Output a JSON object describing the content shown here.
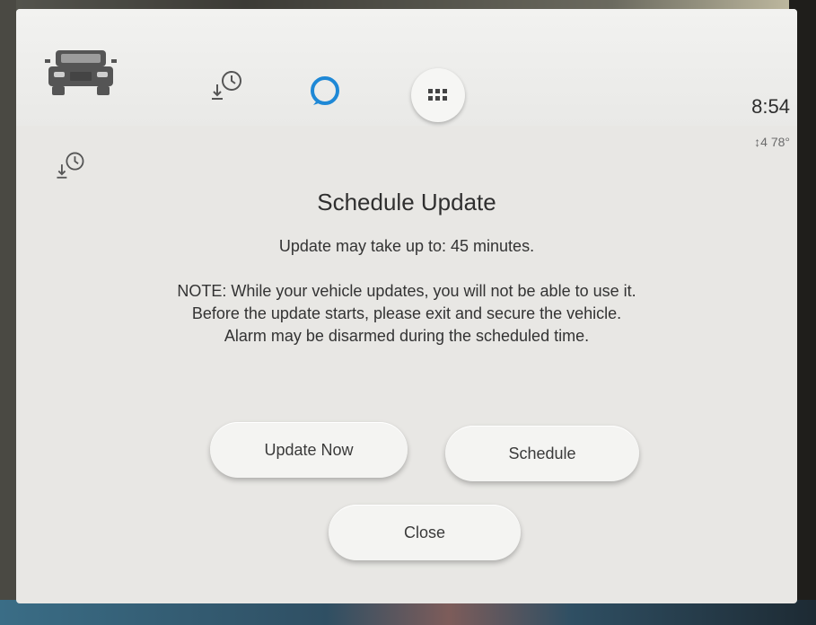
{
  "topbar": {
    "icons": [
      "truck-icon",
      "download-clock-icon",
      "alexa-icon",
      "apps-grid-icon"
    ],
    "time": "8:54",
    "weather": "↕4 78°"
  },
  "dialog": {
    "icon": "download-clock-icon",
    "title": "Schedule Update",
    "subtitle": "Update may take up to: 45 minutes.",
    "note_lines": [
      "NOTE: While your vehicle updates, you will not be able to use it.",
      "Before the update starts, please exit and secure the vehicle.",
      "Alarm may be disarmed during the scheduled time."
    ],
    "buttons": {
      "update_now": "Update Now",
      "schedule": "Schedule",
      "close": "Close"
    }
  },
  "colors": {
    "screen_bg": "#e8e7e4",
    "alexa_accent": "#1e88d6",
    "text": "#333333"
  }
}
